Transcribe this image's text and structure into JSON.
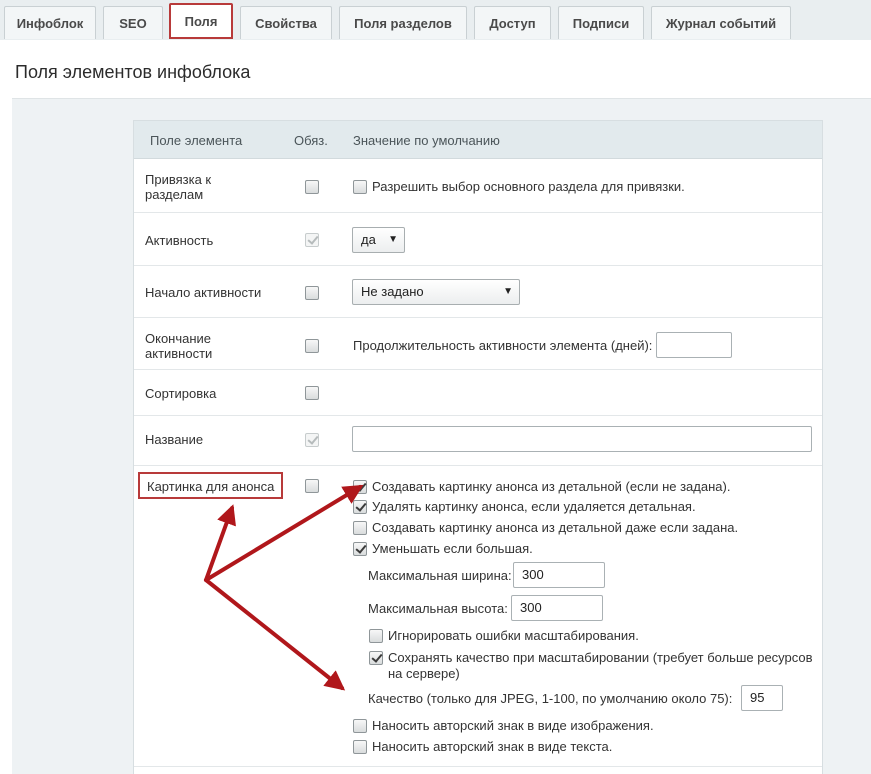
{
  "tabs": [
    {
      "label": "Инфоблок"
    },
    {
      "label": "SEO"
    },
    {
      "label": "Поля"
    },
    {
      "label": "Свойства"
    },
    {
      "label": "Поля разделов"
    },
    {
      "label": "Доступ"
    },
    {
      "label": "Подписи"
    },
    {
      "label": "Журнал событий"
    }
  ],
  "active_tab": "Поля",
  "page": {
    "title": "Поля элементов инфоблока"
  },
  "table": {
    "headers": {
      "field": "Поле элемента",
      "required": "Обяз.",
      "default": "Значение по умолчанию"
    }
  },
  "rows": {
    "sections": {
      "label": "Привязка к разделам",
      "required": false,
      "option": "Разрешить выбор основного раздела для привязки.",
      "option_checked": false
    },
    "active": {
      "label": "Активность",
      "required": true,
      "select_value": "да"
    },
    "active_from": {
      "label": "Начало активности",
      "required": false,
      "select_value": "Не задано"
    },
    "active_to": {
      "label": "Окончание активности",
      "required": false,
      "duration_label": "Продолжительность активности элемента (дней):",
      "duration_value": ""
    },
    "sort": {
      "label": "Сортировка",
      "required": false
    },
    "name": {
      "label": "Название",
      "required": true,
      "value": ""
    },
    "preview_picture": {
      "label": "Картинка для анонса",
      "required": false,
      "options": {
        "from_detail": {
          "label": "Создавать картинку анонса из детальной (если не задана).",
          "checked": true
        },
        "delete_with_detail": {
          "label": "Удалять картинку анонса, если удаляется детальная.",
          "checked": true
        },
        "from_detail_always": {
          "label": "Создавать картинку анонса из детальной даже если задана.",
          "checked": false
        },
        "scale": {
          "label": "Уменьшать если большая.",
          "checked": true
        },
        "max_width": {
          "label": "Максимальная ширина:",
          "value": "300"
        },
        "max_height": {
          "label": "Максимальная высота:",
          "value": "300"
        },
        "ignore_errors": {
          "label": "Игнорировать ошибки масштабирования.",
          "checked": false
        },
        "keep_quality": {
          "label_line1": "Сохранять качество при масштабировании (требует больше ресурсов",
          "label_line2": "на сервере)",
          "checked": true
        },
        "jpeg_quality": {
          "label": "Качество (только для JPEG, 1-100, по умолчанию около 75):",
          "value": "95"
        },
        "watermark_image": {
          "label": "Наносить авторский знак в виде изображения.",
          "checked": false
        },
        "watermark_text": {
          "label": "Наносить авторский знак в виде текста.",
          "checked": false
        }
      }
    }
  },
  "colors": {
    "highlight": "#b83a3a",
    "header_bg": "#e2eaed",
    "panel_bg": "#eef2f4"
  }
}
